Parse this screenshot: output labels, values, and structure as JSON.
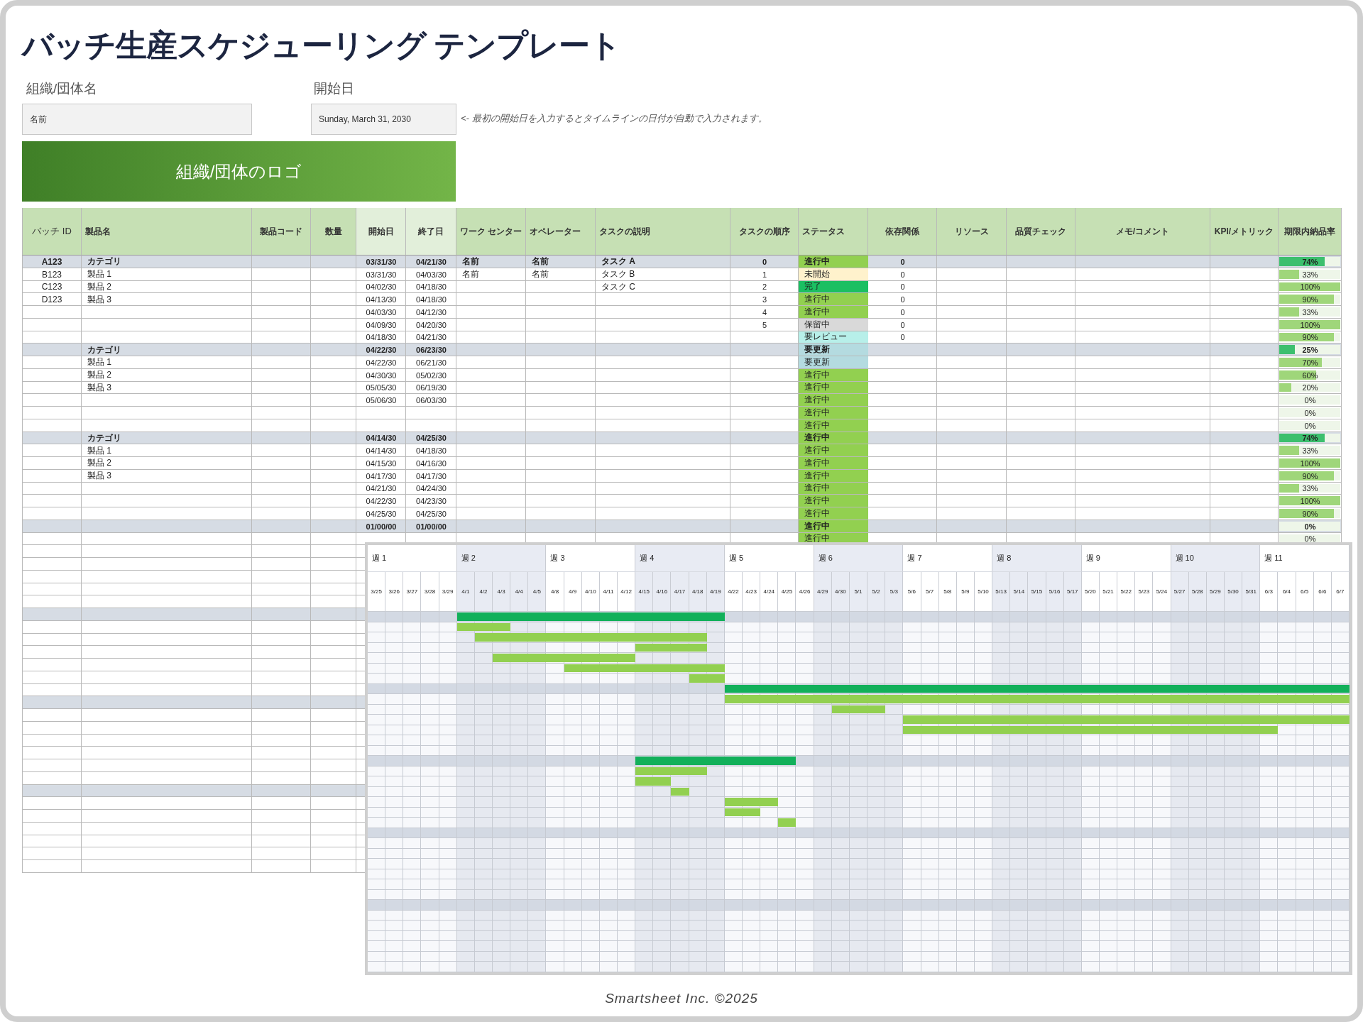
{
  "title": "バッチ生産スケジューリング テンプレート",
  "org": {
    "label": "組織/団体名",
    "value": "名前"
  },
  "start_date": {
    "label": "開始日",
    "value": "Sunday, March 31, 2030",
    "note": "<-  最初の開始日を入力するとタイムラインの日付が自動で入力されます。"
  },
  "logo": {
    "text": "組織/団体のロゴ"
  },
  "table": {
    "columns": [
      "バッチ ID",
      "製品名",
      "製品コード",
      "数量",
      "開始日",
      "終了日",
      "ワーク センター",
      "オペレーター",
      "タスクの説明",
      "タスクの順序",
      "ステータス",
      "依存関係",
      "リソース",
      "品質チェック",
      "メモ/コメント",
      "KPI/メトリック",
      "期限内納品率"
    ],
    "rows": [
      {
        "kind": "category",
        "batch_id": "A123",
        "product": "カテゴリ",
        "start": "03/31/30",
        "end": "04/21/30",
        "work_center": "名前",
        "operator": "名前",
        "task": "タスク A",
        "order": "0",
        "status": {
          "label": "進行中",
          "color": "#92d050"
        },
        "dependency": "0",
        "on_time": {
          "text": "74%",
          "level": 0.74
        }
      },
      {
        "kind": "item",
        "batch_id": "B123",
        "product": "製品 1",
        "start": "03/31/30",
        "end": "04/03/30",
        "work_center": "名前",
        "operator": "名前",
        "task": "タスク B",
        "order": "1",
        "status": {
          "label": "未開始",
          "color": "#fff2cc"
        },
        "dependency": "0",
        "on_time": {
          "text": "33%",
          "level": 0.33
        }
      },
      {
        "kind": "item",
        "batch_id": "C123",
        "product": "製品 2",
        "start": "04/02/30",
        "end": "04/18/30",
        "task": "タスク C",
        "order": "2",
        "status": {
          "label": "完了",
          "color": "#1bbf62"
        },
        "dependency": "0",
        "on_time": {
          "text": "100%",
          "level": 1
        }
      },
      {
        "kind": "item",
        "batch_id": "D123",
        "product": "製品 3",
        "start": "04/13/30",
        "end": "04/18/30",
        "order": "3",
        "status": {
          "label": "進行中",
          "color": "#92d050"
        },
        "dependency": "0",
        "on_time": {
          "text": "90%",
          "level": 0.9
        }
      },
      {
        "kind": "item",
        "start": "04/03/30",
        "end": "04/12/30",
        "order": "4",
        "status": {
          "label": "進行中",
          "color": "#92d050"
        },
        "dependency": "0",
        "on_time": {
          "text": "33%",
          "level": 0.33
        }
      },
      {
        "kind": "item",
        "start": "04/09/30",
        "end": "04/20/30",
        "order": "5",
        "status": {
          "label": "保留中",
          "color": "#d9d9d9"
        },
        "dependency": "0",
        "on_time": {
          "text": "100%",
          "level": 1
        }
      },
      {
        "kind": "item",
        "start": "04/18/30",
        "end": "04/21/30",
        "status": {
          "label": "要レビュー",
          "color": "#b7efe9"
        },
        "dependency": "0",
        "on_time": {
          "text": "90%",
          "level": 0.9
        }
      },
      {
        "kind": "category",
        "product": "カテゴリ",
        "start": "04/22/30",
        "end": "06/23/30",
        "status": {
          "label": "要更新",
          "color": "#b4dbe0"
        },
        "on_time": {
          "text": "25%",
          "level": 0.25
        }
      },
      {
        "kind": "item",
        "product": "製品 1",
        "start": "04/22/30",
        "end": "06/21/30",
        "status": {
          "label": "要更新",
          "color": "#b4dbe0"
        },
        "on_time": {
          "text": "70%",
          "level": 0.7
        }
      },
      {
        "kind": "item",
        "product": "製品 2",
        "start": "04/30/30",
        "end": "05/02/30",
        "status": {
          "label": "進行中",
          "color": "#92d050"
        },
        "on_time": {
          "text": "60%",
          "level": 0.6
        }
      },
      {
        "kind": "item",
        "product": "製品 3",
        "start": "05/05/30",
        "end": "06/19/30",
        "status": {
          "label": "進行中",
          "color": "#92d050"
        },
        "on_time": {
          "text": "20%",
          "level": 0.2
        }
      },
      {
        "kind": "item",
        "start": "05/06/30",
        "end": "06/03/30",
        "status": {
          "label": "進行中",
          "color": "#92d050"
        },
        "on_time": {
          "text": "0%",
          "level": 0
        }
      },
      {
        "kind": "item",
        "status": {
          "label": "進行中",
          "color": "#92d050"
        },
        "on_time": {
          "text": "0%",
          "level": 0
        }
      },
      {
        "kind": "item",
        "status": {
          "label": "進行中",
          "color": "#92d050"
        },
        "on_time": {
          "text": "0%",
          "level": 0
        }
      },
      {
        "kind": "category",
        "product": "カテゴリ",
        "start": "04/14/30",
        "end": "04/25/30",
        "status": {
          "label": "進行中",
          "color": "#92d050"
        },
        "on_time": {
          "text": "74%",
          "level": 0.74
        }
      },
      {
        "kind": "item",
        "product": "製品 1",
        "start": "04/14/30",
        "end": "04/18/30",
        "status": {
          "label": "進行中",
          "color": "#92d050"
        },
        "on_time": {
          "text": "33%",
          "level": 0.33
        }
      },
      {
        "kind": "item",
        "product": "製品 2",
        "start": "04/15/30",
        "end": "04/16/30",
        "status": {
          "label": "進行中",
          "color": "#92d050"
        },
        "on_time": {
          "text": "100%",
          "level": 1
        }
      },
      {
        "kind": "item",
        "product": "製品 3",
        "start": "04/17/30",
        "end": "04/17/30",
        "status": {
          "label": "進行中",
          "color": "#92d050"
        },
        "on_time": {
          "text": "90%",
          "level": 0.9
        }
      },
      {
        "kind": "item",
        "start": "04/21/30",
        "end": "04/24/30",
        "status": {
          "label": "進行中",
          "color": "#92d050"
        },
        "on_time": {
          "text": "33%",
          "level": 0.33
        }
      },
      {
        "kind": "item",
        "start": "04/22/30",
        "end": "04/23/30",
        "status": {
          "label": "進行中",
          "color": "#92d050"
        },
        "on_time": {
          "text": "100%",
          "level": 1
        }
      },
      {
        "kind": "item",
        "start": "04/25/30",
        "end": "04/25/30",
        "status": {
          "label": "進行中",
          "color": "#92d050"
        },
        "on_time": {
          "text": "90%",
          "level": 0.9
        }
      },
      {
        "kind": "category",
        "start": "01/00/00",
        "end": "01/00/00",
        "status": {
          "label": "進行中",
          "color": "#92d050"
        },
        "on_time": {
          "text": "0%",
          "level": 0
        }
      },
      {
        "kind": "item",
        "status": {
          "label": "進行中",
          "color": "#92d050"
        },
        "on_time": {
          "text": "0%",
          "level": 0
        }
      },
      {
        "kind": "item"
      },
      {
        "kind": "item"
      },
      {
        "kind": "item"
      },
      {
        "kind": "item"
      },
      {
        "kind": "item"
      },
      {
        "kind": "category"
      },
      {
        "kind": "item"
      },
      {
        "kind": "item"
      },
      {
        "kind": "item"
      },
      {
        "kind": "item"
      },
      {
        "kind": "item"
      },
      {
        "kind": "item"
      },
      {
        "kind": "category"
      },
      {
        "kind": "item"
      },
      {
        "kind": "item"
      },
      {
        "kind": "item"
      },
      {
        "kind": "item"
      },
      {
        "kind": "item"
      },
      {
        "kind": "item"
      },
      {
        "kind": "category"
      },
      {
        "kind": "item"
      },
      {
        "kind": "item"
      },
      {
        "kind": "item"
      },
      {
        "kind": "item"
      },
      {
        "kind": "item"
      },
      {
        "kind": "item"
      }
    ]
  },
  "gantt": {
    "weeks": [
      "週 1",
      "週 2",
      "週 3",
      "週 4",
      "週 5",
      "週 6",
      "週 7",
      "週 8",
      "週 9",
      "週 10",
      "週 11"
    ],
    "days": [
      "3/25",
      "3/26",
      "3/27",
      "3/28",
      "3/29",
      "4/1",
      "4/2",
      "4/3",
      "4/4",
      "4/5",
      "4/8",
      "4/9",
      "4/10",
      "4/11",
      "4/12",
      "4/15",
      "4/16",
      "4/17",
      "4/18",
      "4/19",
      "4/22",
      "4/23",
      "4/24",
      "4/25",
      "4/26",
      "4/29",
      "4/30",
      "5/1",
      "5/2",
      "5/3",
      "5/6",
      "5/7",
      "5/8",
      "5/9",
      "5/10",
      "5/13",
      "5/14",
      "5/15",
      "5/16",
      "5/17",
      "5/20",
      "5/21",
      "5/22",
      "5/23",
      "5/24",
      "5/27",
      "5/28",
      "5/29",
      "5/30",
      "5/31",
      "6/3",
      "6/4",
      "6/5",
      "6/6",
      "6/7"
    ],
    "rows": [
      {
        "kind": "category"
      },
      {
        "kind": "item"
      },
      {
        "kind": "item"
      },
      {
        "kind": "item"
      },
      {
        "kind": "item"
      },
      {
        "kind": "item"
      },
      {
        "kind": "item"
      },
      {
        "kind": "category"
      },
      {
        "kind": "item"
      },
      {
        "kind": "item"
      },
      {
        "kind": "item"
      },
      {
        "kind": "item"
      },
      {
        "kind": "item"
      },
      {
        "kind": "item"
      },
      {
        "kind": "category"
      },
      {
        "kind": "item"
      },
      {
        "kind": "item"
      },
      {
        "kind": "item"
      },
      {
        "kind": "item"
      },
      {
        "kind": "item"
      },
      {
        "kind": "item"
      },
      {
        "kind": "category"
      },
      {
        "kind": "item"
      },
      {
        "kind": "item"
      },
      {
        "kind": "item"
      },
      {
        "kind": "item"
      },
      {
        "kind": "item"
      },
      {
        "kind": "item"
      },
      {
        "kind": "category"
      },
      {
        "kind": "item"
      },
      {
        "kind": "item"
      },
      {
        "kind": "item"
      },
      {
        "kind": "item"
      },
      {
        "kind": "item"
      },
      {
        "kind": "item"
      }
    ]
  },
  "footer": "Smartsheet Inc. ©2025"
}
